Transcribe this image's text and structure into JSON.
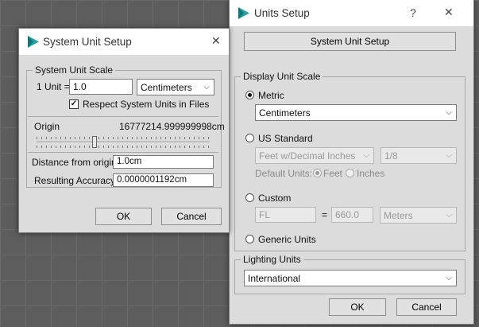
{
  "system_unit_setup": {
    "title": "System Unit Setup",
    "close_glyph": "✕",
    "scale_group_label": "System Unit Scale",
    "one_unit_label": "1 Unit =",
    "one_unit_value": "1.0",
    "unit_select": "Centimeters",
    "respect_label": "Respect System Units in Files",
    "respect_checked": true,
    "check_glyph": "✓",
    "origin_label": "Origin",
    "origin_value": "16777214.999999998cm",
    "distance_label": "Distance from origin:",
    "distance_value": "1.0cm",
    "accuracy_label": "Resulting Accuracy:",
    "accuracy_value": "0.0000001192cm",
    "ok_label": "OK",
    "cancel_label": "Cancel"
  },
  "units_setup": {
    "title": "Units Setup",
    "help_glyph": "?",
    "close_glyph": "✕",
    "system_unit_setup_button": "System Unit Setup",
    "display_group_label": "Display Unit Scale",
    "metric_label": "Metric",
    "metric_select": "Centimeters",
    "us_standard_label": "US Standard",
    "us_select": "Feet w/Decimal Inches",
    "us_fraction_select": "1/8",
    "default_units_label": "Default Units:",
    "feet_label": "Feet",
    "inches_label": "Inches",
    "custom_label": "Custom",
    "custom_name": "FL",
    "custom_equals": "=",
    "custom_value": "660.0",
    "custom_unit_select": "Meters",
    "generic_label": "Generic Units",
    "lighting_group_label": "Lighting Units",
    "lighting_select": "International",
    "ok_label": "OK",
    "cancel_label": "Cancel"
  },
  "icons": {
    "app": "3ds-max-icon",
    "dropdown": "chevron-down-icon"
  },
  "colors": {
    "window_bg": "#dcdcdc",
    "titlebar_bg": "#ffffff",
    "viewport_bg": "#5d5d5d",
    "app_icon": "#1fa3a6"
  }
}
